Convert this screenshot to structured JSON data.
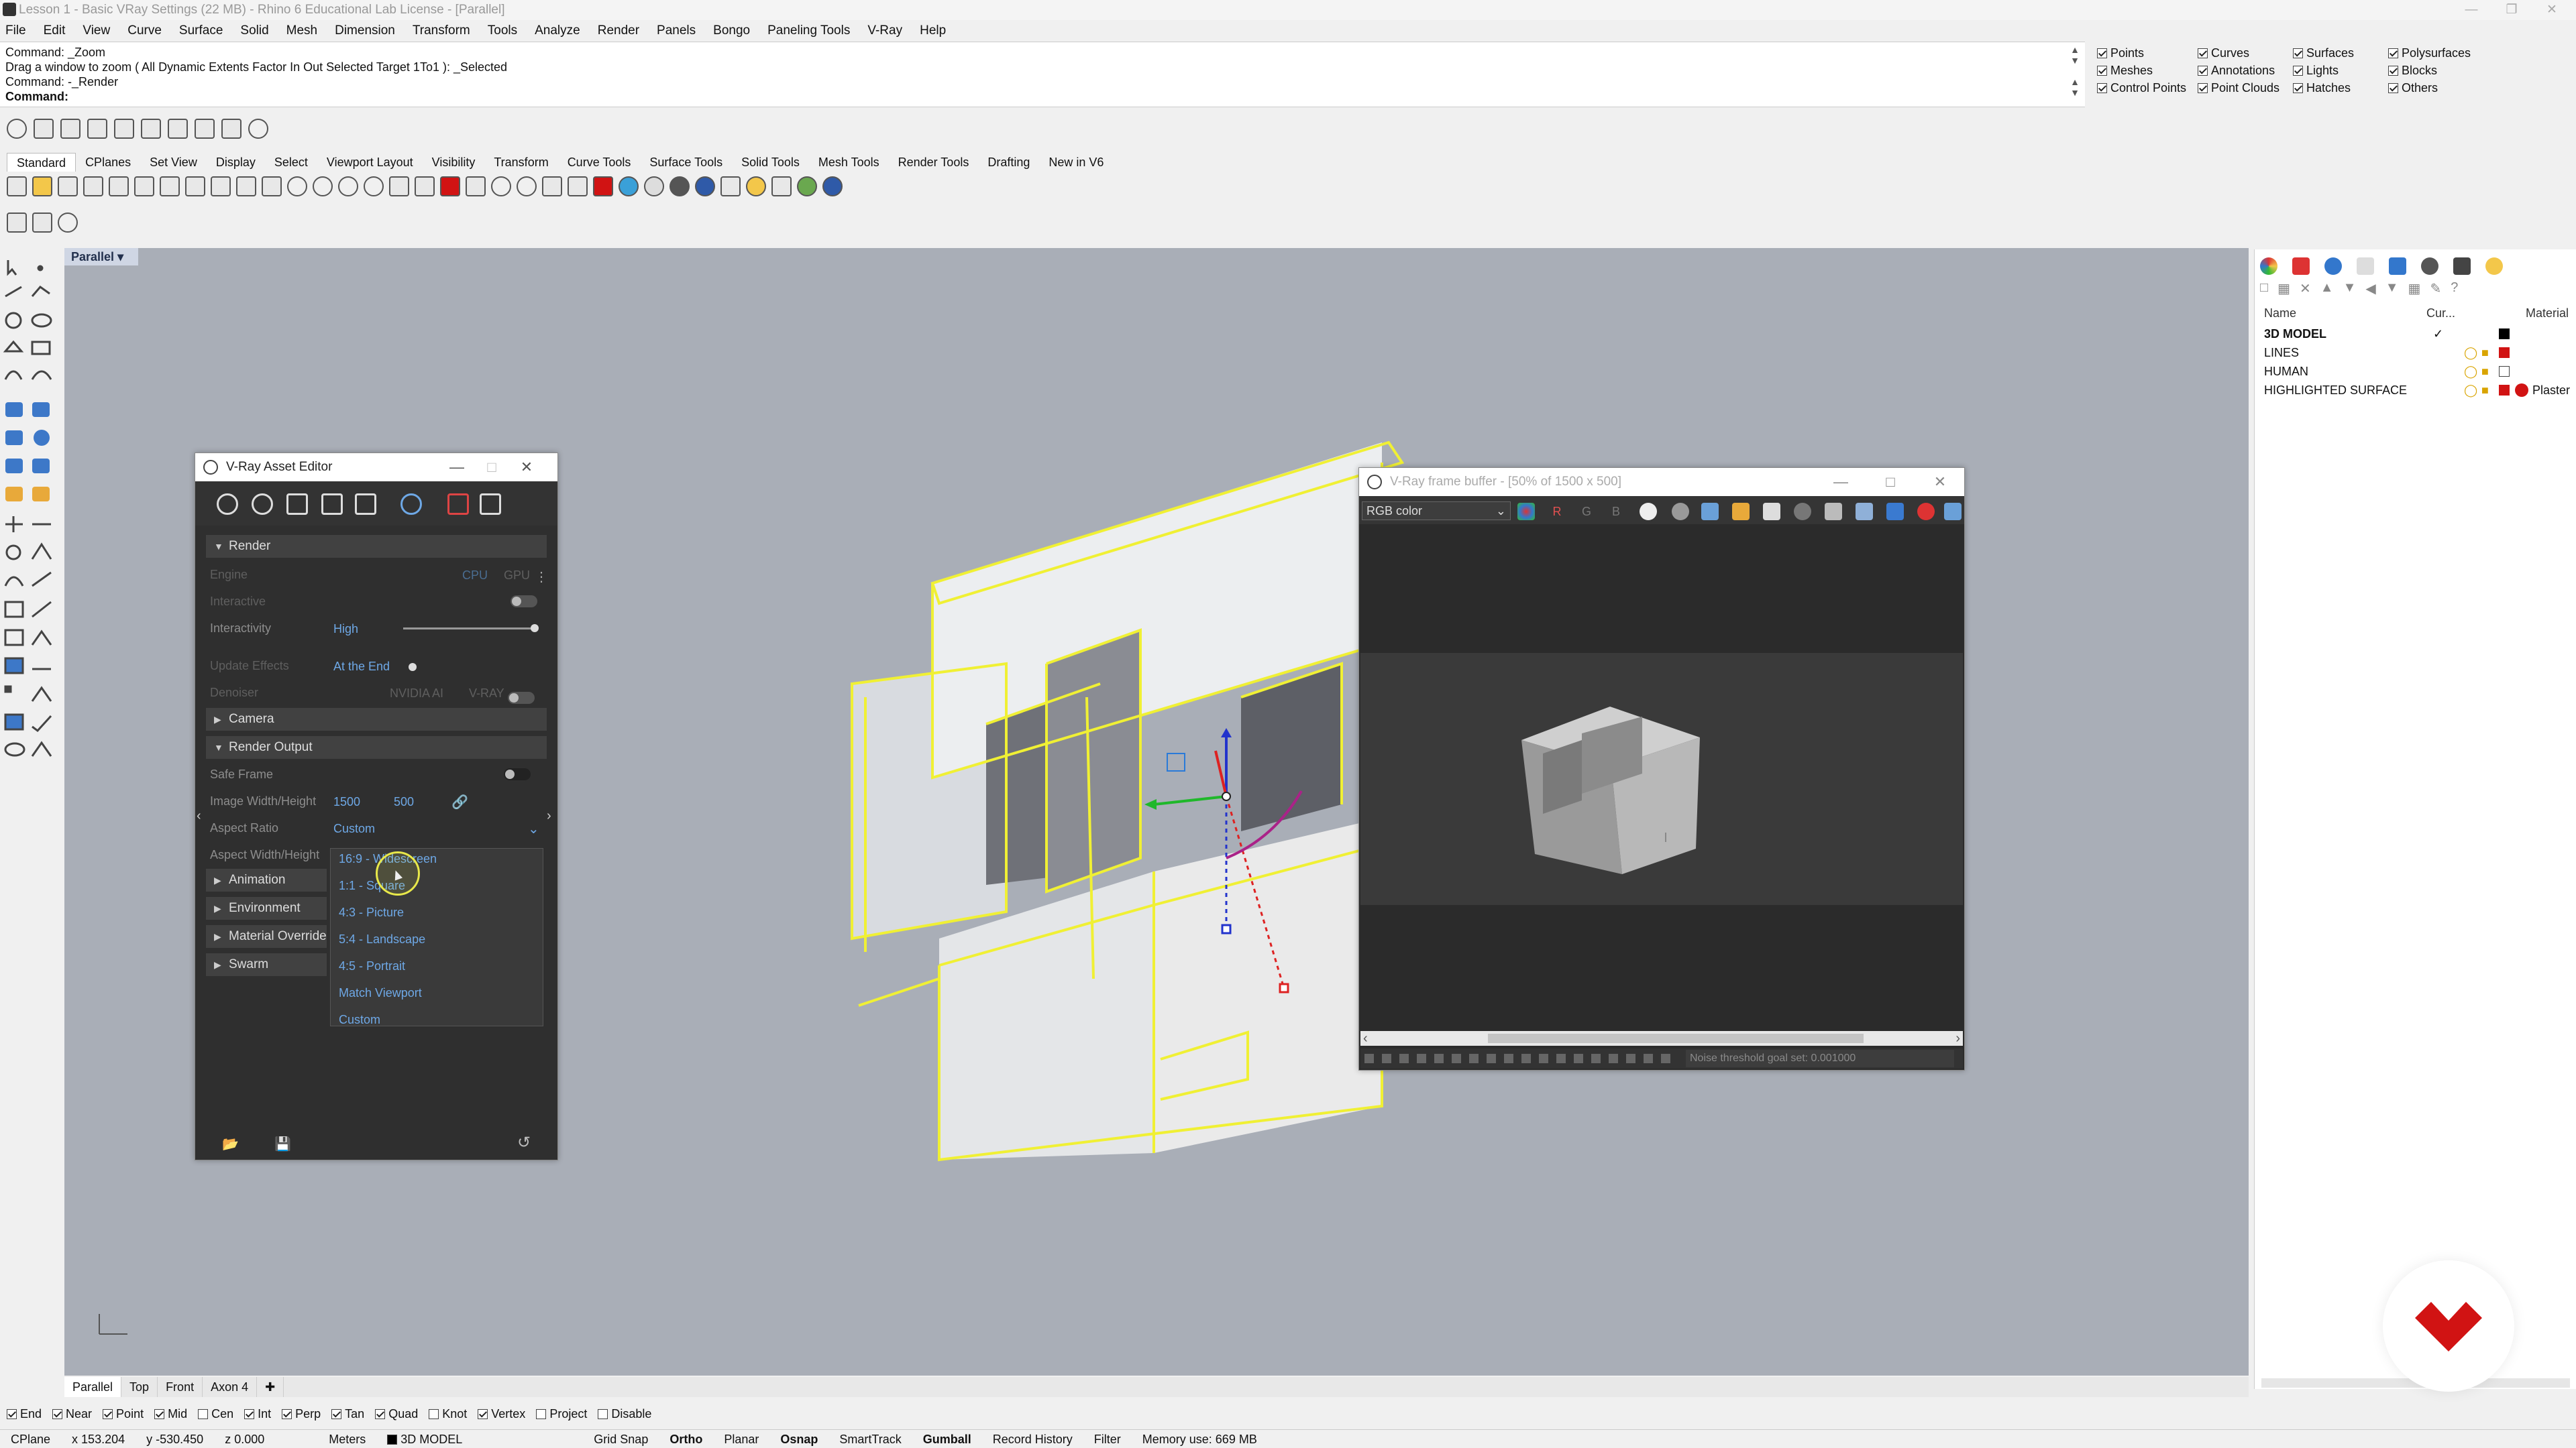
{
  "window": {
    "title": "Lesson 1 - Basic VRay Settings (22 MB) - Rhino 6 Educational Lab License - [Parallel]"
  },
  "menu": [
    "File",
    "Edit",
    "View",
    "Curve",
    "Surface",
    "Solid",
    "Mesh",
    "Dimension",
    "Transform",
    "Tools",
    "Analyze",
    "Render",
    "Panels",
    "Bongo",
    "Paneling Tools",
    "V-Ray",
    "Help"
  ],
  "command": {
    "history": [
      "Command: _Zoom",
      "Drag a window to zoom ( All  Dynamic  Extents  Factor  In  Out  Selected  Target  1To1 ): _Selected",
      "Command: -_Render"
    ],
    "prompt": "Command:"
  },
  "select_filter": {
    "columns": [
      [
        "Points",
        "Meshes",
        "Control Points"
      ],
      [
        "Curves",
        "Annotations",
        "Point Clouds"
      ],
      [
        "Surfaces",
        "Lights",
        "Hatches"
      ],
      [
        "Polysurfaces",
        "Blocks",
        "Others"
      ]
    ]
  },
  "toolbar_tabs": [
    "Standard",
    "CPlanes",
    "Set View",
    "Display",
    "Select",
    "Viewport Layout",
    "Visibility",
    "Transform",
    "Curve Tools",
    "Surface Tools",
    "Solid Tools",
    "Mesh Tools",
    "Render Tools",
    "Drafting",
    "New in V6"
  ],
  "viewport": {
    "name": "Parallel"
  },
  "asset_editor": {
    "title": "V-Ray Asset Editor",
    "render_section": "Render",
    "engine_label": "Engine",
    "engine_cpu": "CPU",
    "engine_gpu": "GPU",
    "interactive_label": "Interactive",
    "interactivity_label": "Interactivity",
    "interactivity_value": "High",
    "update_effects_label": "Update Effects",
    "update_effects_value": "At the End",
    "denoiser_label": "Denoiser",
    "denoiser_nvidia": "NVIDIA AI",
    "denoiser_vray": "V-RAY",
    "camera_section": "Camera",
    "render_output_section": "Render Output",
    "safe_frame_label": "Safe Frame",
    "image_wh_label": "Image Width/Height",
    "image_width": "1500",
    "image_height": "500",
    "aspect_ratio_label": "Aspect Ratio",
    "aspect_ratio_value": "Custom",
    "aspect_wh_label": "Aspect Width/Height",
    "collapsed_sections": [
      "Animation",
      "Environment",
      "Material Override",
      "Swarm"
    ],
    "aspect_options": [
      "16:9 - Widescreen",
      "1:1 - Square",
      "4:3 - Picture",
      "5:4 - Landscape",
      "4:5 - Portrait",
      "Match Viewport",
      "Custom"
    ]
  },
  "vfb": {
    "title": "V-Ray frame buffer - [50% of 1500 x 500]",
    "channel": "RGB color",
    "channels": [
      "R",
      "G",
      "B"
    ],
    "status": "Noise threshold goal set: 0.001000"
  },
  "layers": {
    "col_name": "Name",
    "col_current": "Cur...",
    "col_material": "Material",
    "rows": [
      {
        "name": "3D MODEL",
        "current": "✓",
        "color": "#000000",
        "material": ""
      },
      {
        "name": "LINES",
        "current": "",
        "color": "#d11313",
        "material": ""
      },
      {
        "name": "HUMAN",
        "current": "",
        "color": "#ffffff",
        "material": ""
      },
      {
        "name": "HIGHLIGHTED SURFACE",
        "current": "",
        "color": "#d11313",
        "material": "Plaster"
      }
    ]
  },
  "viewport_tabs": [
    "Parallel",
    "Top",
    "Front",
    "Axon 4"
  ],
  "osnaps": [
    {
      "label": "End",
      "on": true
    },
    {
      "label": "Near",
      "on": true
    },
    {
      "label": "Point",
      "on": true
    },
    {
      "label": "Mid",
      "on": true
    },
    {
      "label": "Cen",
      "on": false
    },
    {
      "label": "Int",
      "on": true
    },
    {
      "label": "Perp",
      "on": true
    },
    {
      "label": "Tan",
      "on": true
    },
    {
      "label": "Quad",
      "on": true
    },
    {
      "label": "Knot",
      "on": false
    },
    {
      "label": "Vertex",
      "on": true
    },
    {
      "label": "Project",
      "on": false
    },
    {
      "label": "Disable",
      "on": false
    }
  ],
  "statusbar": {
    "cplane": "CPlane",
    "x": "x 153.204",
    "y": "y -530.450",
    "z": "z 0.000",
    "units": "Meters",
    "layer": "3D MODEL",
    "toggles": [
      "Grid Snap",
      "Ortho",
      "Planar",
      "Osnap",
      "SmartTrack",
      "Gumball",
      "Record History",
      "Filter"
    ],
    "memory": "Memory use: 669 MB"
  },
  "colors": {
    "accent": "#6ea8e6",
    "selection": "#f0f034",
    "viewport_bg": "#a9aeb7",
    "logo_red": "#d11313"
  }
}
